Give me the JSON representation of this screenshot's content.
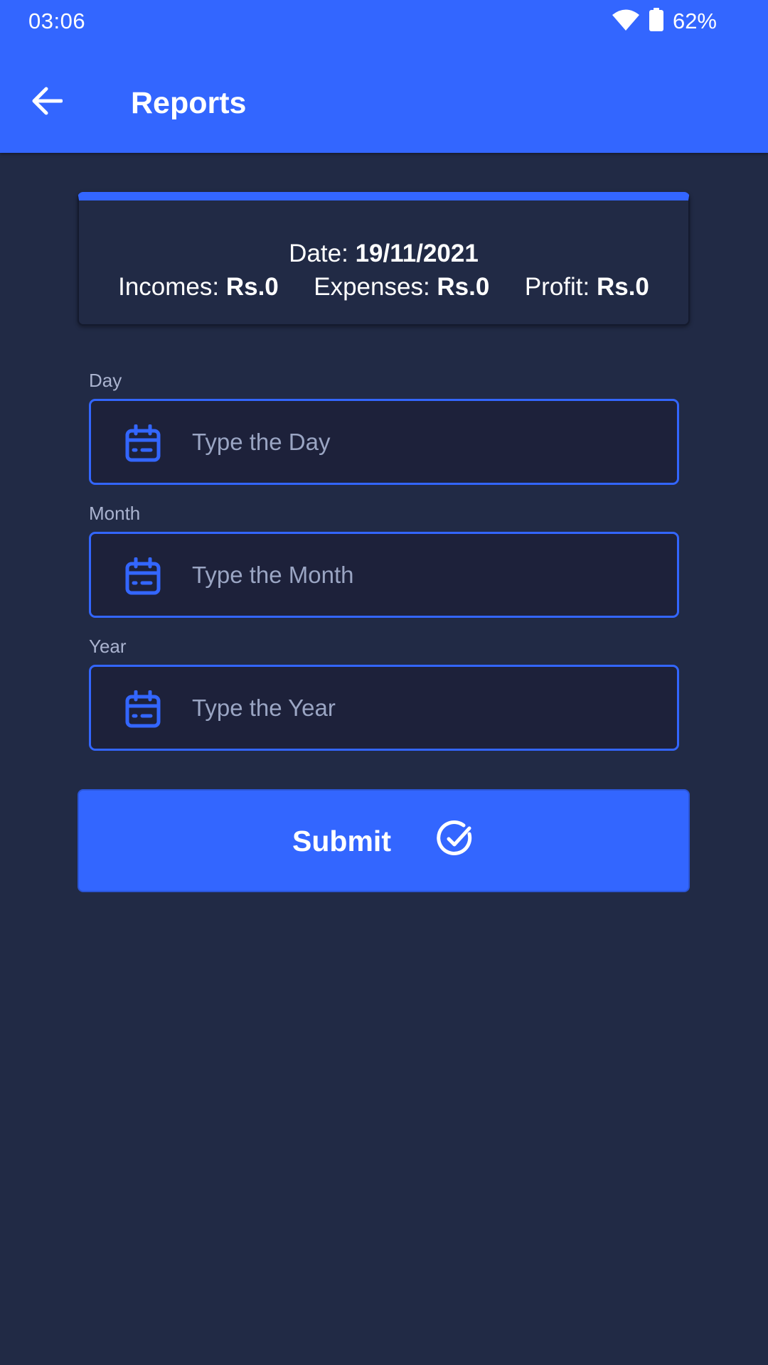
{
  "status_bar": {
    "time": "03:06",
    "battery": "62%",
    "wifi_icon": "wifi-icon",
    "battery_icon": "battery-icon"
  },
  "app_bar": {
    "back_icon": "arrow-left-icon",
    "title": "Reports"
  },
  "summary": {
    "date_label": "Date:",
    "date_value": "19/11/2021",
    "incomes_label": "Incomes:",
    "incomes_value": "Rs.0",
    "expenses_label": "Expenses:",
    "expenses_value": "Rs.0",
    "profit_label": "Profit:",
    "profit_value": "Rs.0"
  },
  "form": {
    "fields": [
      {
        "label": "Day",
        "placeholder": "Type the Day",
        "icon": "calendar-icon"
      },
      {
        "label": "Month",
        "placeholder": "Type the Month",
        "icon": "calendar-icon"
      },
      {
        "label": "Year",
        "placeholder": "Type the Year",
        "icon": "calendar-icon"
      }
    ],
    "submit_label": "Submit",
    "submit_icon": "check-circle-icon"
  },
  "colors": {
    "primary": "#3366ff",
    "background": "#212a45",
    "input_background": "#1d213a",
    "muted_text": "#aab3cf"
  }
}
